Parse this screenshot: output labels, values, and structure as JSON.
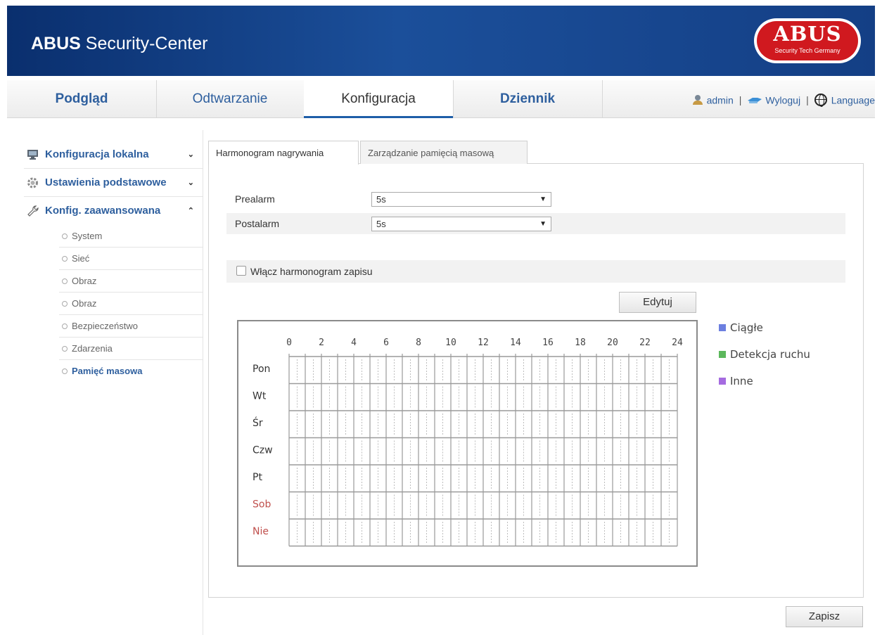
{
  "header": {
    "brand_bold": "ABUS",
    "brand_rest": " Security-Center",
    "logo_word": "ABUS",
    "logo_tag": "Security Tech Germany"
  },
  "nav": {
    "tabs": [
      {
        "label": "Podgląd"
      },
      {
        "label": "Odtwarzanie"
      },
      {
        "label": "Konfiguracja"
      },
      {
        "label": "Dziennik"
      }
    ],
    "user": "admin",
    "logout": "Wyloguj",
    "language": "Language",
    "separator": "|"
  },
  "sidebar": {
    "sections": [
      {
        "label": "Konfiguracja lokalna",
        "chevron": "⌄"
      },
      {
        "label": "Ustawienia podstawowe",
        "chevron": "⌄"
      },
      {
        "label": "Konfig. zaawansowana",
        "chevron": "⌃"
      }
    ],
    "items": [
      {
        "label": "System"
      },
      {
        "label": "Sieć"
      },
      {
        "label": "Obraz"
      },
      {
        "label": "Obraz"
      },
      {
        "label": "Bezpieczeństwo"
      },
      {
        "label": "Zdarzenia"
      },
      {
        "label": "Pamięć masowa"
      }
    ]
  },
  "content_tabs": [
    {
      "label": "Harmonogram nagrywania"
    },
    {
      "label": "Zarządzanie pamięcią masową"
    }
  ],
  "form": {
    "prealarm_label": "Prealarm",
    "prealarm_value": "5s",
    "postalarm_label": "Postalarm",
    "postalarm_value": "5s",
    "dropdown_arrow": "▼",
    "enable_schedule_label": "Włącz harmonogram zapisu",
    "enable_schedule_checked": false,
    "edit_button": "Edytuj",
    "save_button": "Zapisz"
  },
  "schedule": {
    "hours": [
      "0",
      "2",
      "4",
      "6",
      "8",
      "10",
      "12",
      "14",
      "16",
      "18",
      "20",
      "22",
      "24"
    ],
    "days": [
      {
        "label": "Pon",
        "weekend": false
      },
      {
        "label": "Wt",
        "weekend": false
      },
      {
        "label": "Śr",
        "weekend": false
      },
      {
        "label": "Czw",
        "weekend": false
      },
      {
        "label": "Pt",
        "weekend": false
      },
      {
        "label": "Sob",
        "weekend": true
      },
      {
        "label": "Nie",
        "weekend": true
      }
    ],
    "weekend_color": "#c0504d",
    "grid_color": "#9a9a9a"
  },
  "legend": [
    {
      "label": "Ciągłe",
      "color": "#6c7fe0"
    },
    {
      "label": "Detekcja ruchu",
      "color": "#5cb85c"
    },
    {
      "label": "Inne",
      "color": "#a56be0"
    }
  ],
  "colors": {
    "accent": "#1e5ea8",
    "link": "#2e5f9e",
    "header_bg": "#0a2f6e",
    "logo_red": "#d0191f"
  },
  "icons": {
    "user": "user-icon",
    "logout": "logout-icon",
    "language": "globe-icon",
    "local_config": "monitor-icon",
    "basic_settings": "gear-icon",
    "advanced_config": "wrench-icon"
  }
}
